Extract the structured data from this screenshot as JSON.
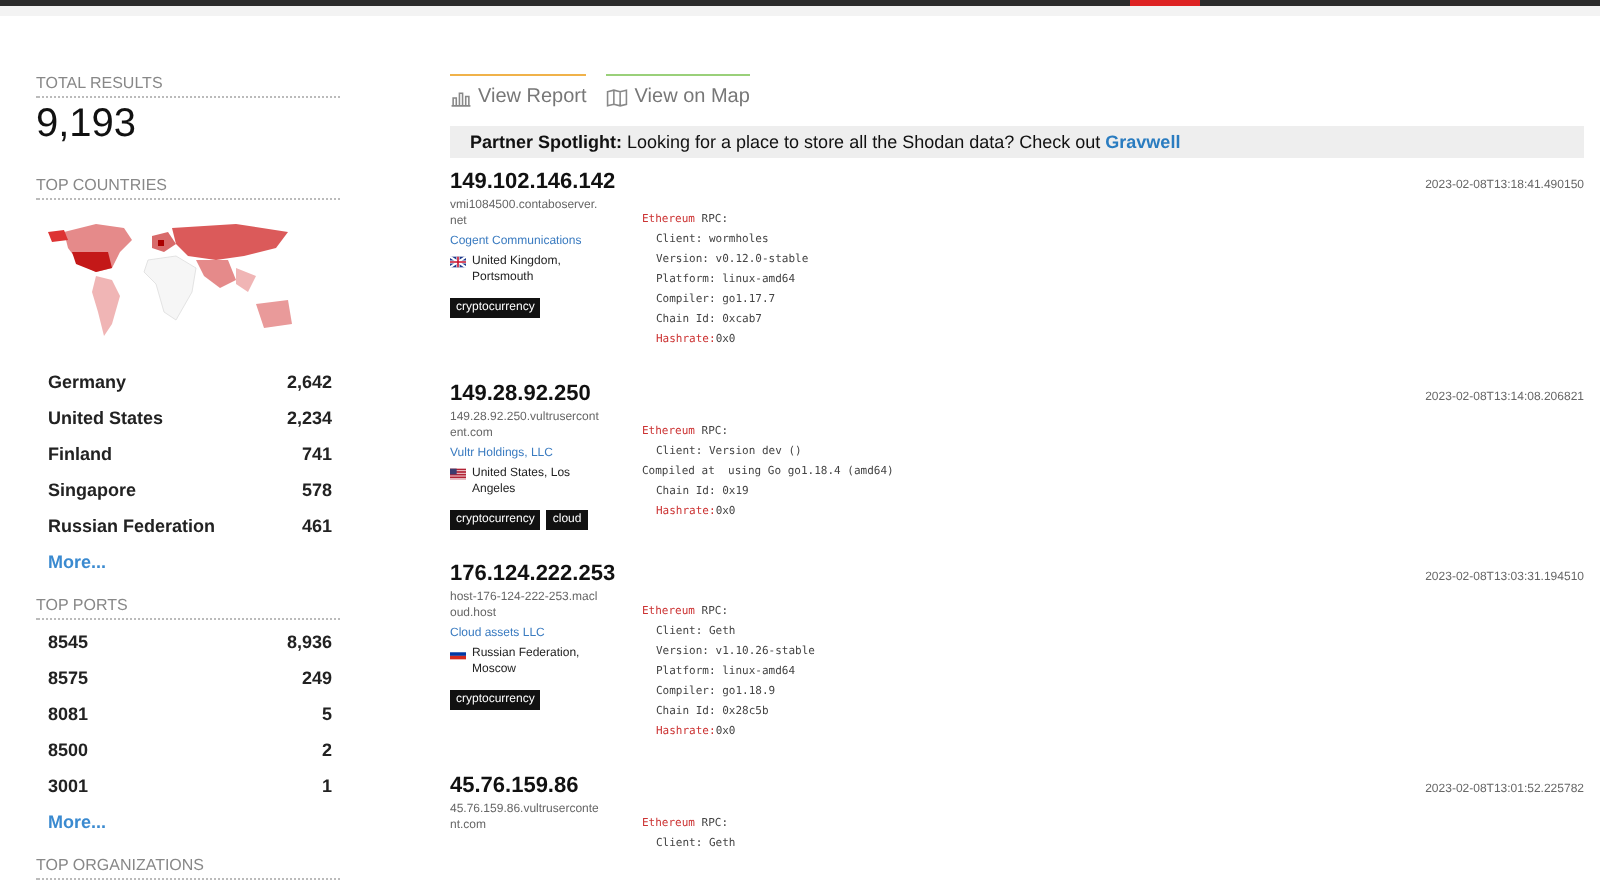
{
  "sidebar": {
    "total_label": "TOTAL RESULTS",
    "total": "9,193",
    "countries": {
      "title": "TOP COUNTRIES",
      "rows": [
        {
          "name": "Germany",
          "count": "2,642"
        },
        {
          "name": "United States",
          "count": "2,234"
        },
        {
          "name": "Finland",
          "count": "741"
        },
        {
          "name": "Singapore",
          "count": "578"
        },
        {
          "name": "Russian Federation",
          "count": "461"
        }
      ],
      "more": "More..."
    },
    "ports": {
      "title": "TOP PORTS",
      "rows": [
        {
          "name": "8545",
          "count": "8,936"
        },
        {
          "name": "8575",
          "count": "249"
        },
        {
          "name": "8081",
          "count": "5"
        },
        {
          "name": "8500",
          "count": "2"
        },
        {
          "name": "3001",
          "count": "1"
        }
      ],
      "more": "More..."
    },
    "organizations_title": "TOP ORGANIZATIONS"
  },
  "tabs": [
    {
      "label": "View Report",
      "kind": "report"
    },
    {
      "label": "View on Map",
      "kind": "map"
    }
  ],
  "spotlight": {
    "label": "Partner Spotlight:",
    "text": "Looking for a place to store all the Shodan data? Check out",
    "link": "Gravwell"
  },
  "results": [
    {
      "ip": "149.102.146.142",
      "hostname": "vmi1084500.contaboserver.net",
      "org": "Cogent Communications",
      "location": {
        "kind": "uk",
        "text": "United Kingdom, Portsmouth"
      },
      "tags": [
        "cryptocurrency"
      ],
      "timestamp": "2023-02-08T13:18:41.490150",
      "banner": {
        "protocol": "Ethereum",
        "header": "RPC:",
        "lines": [
          {
            "text": "Client: wormholes",
            "indented": true
          },
          {
            "text": "Version: v0.12.0-stable",
            "indented": true
          },
          {
            "text": "Platform: linux-amd64",
            "indented": true
          },
          {
            "text": "Compiler: go1.17.7",
            "indented": true
          },
          {
            "text": "Chain Id: 0xcab7",
            "indented": true
          },
          {
            "label": "Hashrate:",
            "text": "0x0",
            "indented": true
          }
        ]
      }
    },
    {
      "ip": "149.28.92.250",
      "hostname": "149.28.92.250.vultrusercontent.com",
      "org": "Vultr Holdings, LLC",
      "location": {
        "kind": "us",
        "text": "United States, Los Angeles"
      },
      "tags": [
        "cryptocurrency",
        "cloud"
      ],
      "timestamp": "2023-02-08T13:14:08.206821",
      "banner": {
        "protocol": "Ethereum",
        "header": "RPC:",
        "lines": [
          {
            "text": "Client: Version dev ()",
            "indented": true
          },
          {
            "text": "Compiled at  using Go go1.18.4 (amd64)",
            "indented": false
          },
          {
            "text": "Chain Id: 0x19",
            "indented": true
          },
          {
            "label": "Hashrate:",
            "text": "0x0",
            "indented": true
          }
        ]
      }
    },
    {
      "ip": "176.124.222.253",
      "hostname": "host-176-124-222-253.macloud.host",
      "org": "Cloud assets LLC",
      "location": {
        "kind": "ru",
        "text": "Russian Federation, Moscow"
      },
      "tags": [
        "cryptocurrency"
      ],
      "timestamp": "2023-02-08T13:03:31.194510",
      "banner": {
        "protocol": "Ethereum",
        "header": "RPC:",
        "lines": [
          {
            "text": "Client: Geth",
            "indented": true
          },
          {
            "text": "Version: v1.10.26-stable",
            "indented": true
          },
          {
            "text": "Platform: linux-amd64",
            "indented": true
          },
          {
            "text": "Compiler: go1.18.9",
            "indented": true
          },
          {
            "text": "Chain Id: 0x28c5b",
            "indented": true
          },
          {
            "label": "Hashrate:",
            "text": "0x0",
            "indented": true
          }
        ]
      }
    },
    {
      "ip": "45.76.159.86",
      "hostname": "45.76.159.86.vultrusercontent.com",
      "timestamp": "2023-02-08T13:01:52.225782",
      "banner": {
        "protocol": "Ethereum",
        "header": "RPC:",
        "lines": [
          {
            "text": "Client: Geth",
            "indented": true
          }
        ]
      }
    }
  ]
}
